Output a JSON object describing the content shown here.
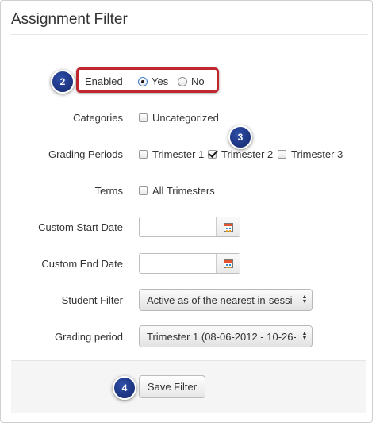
{
  "panel": {
    "title": "Assignment Filter"
  },
  "enabled": {
    "label": "Enabled",
    "yes_label": "Yes",
    "no_label": "No",
    "selected": "Yes"
  },
  "categories": {
    "label": "Categories",
    "options": [
      "Uncategorized"
    ],
    "checked": [
      false
    ]
  },
  "grading_periods": {
    "label": "Grading Periods",
    "options": [
      "Trimester 1",
      "Trimester 2",
      "Trimester 3"
    ],
    "checked": [
      false,
      true,
      false
    ]
  },
  "terms": {
    "label": "Terms",
    "options": [
      "All Trimesters"
    ],
    "checked": [
      false
    ]
  },
  "custom_start_date": {
    "label": "Custom Start Date",
    "value": ""
  },
  "custom_end_date": {
    "label": "Custom End Date",
    "value": ""
  },
  "student_filter": {
    "label": "Student Filter",
    "value": "Active as of the nearest in-sessi"
  },
  "grading_period": {
    "label": "Grading period",
    "value": "Trimester 1 (08-06-2012 - 10-26-"
  },
  "footer": {
    "save_label": "Save Filter"
  },
  "callouts": [
    "2",
    "3",
    "4"
  ],
  "colors": {
    "highlight": "#c0262d",
    "badge": "#1a3380"
  }
}
